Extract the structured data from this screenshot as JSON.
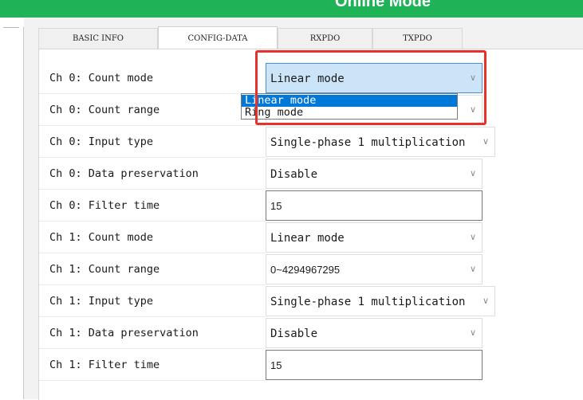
{
  "header": {
    "title": "Online Mode"
  },
  "tabs": [
    {
      "label": "BASIC INFO",
      "active": false
    },
    {
      "label": "CONFIG-DATA",
      "active": true
    },
    {
      "label": "RXPDO",
      "active": false
    },
    {
      "label": "TXPDO",
      "active": false
    }
  ],
  "rows": [
    {
      "label": "Ch 0: Count mode",
      "control": "select",
      "value": "Linear mode"
    },
    {
      "label": "Ch 0: Count range",
      "control": "select",
      "value": ""
    },
    {
      "label": "Ch 0: Input type",
      "control": "select",
      "value": "Single-phase 1 multiplication"
    },
    {
      "label": "Ch 0: Data preservation",
      "control": "select",
      "value": "Disable"
    },
    {
      "label": "Ch 0: Filter time",
      "control": "input",
      "value": "15"
    },
    {
      "label": "Ch 1: Count mode",
      "control": "select",
      "value": "Linear mode"
    },
    {
      "label": "Ch 1: Count range",
      "control": "select",
      "value": "0~4294967295"
    },
    {
      "label": "Ch 1: Input type",
      "control": "select",
      "value": "Single-phase 1 multiplication"
    },
    {
      "label": "Ch 1: Data preservation",
      "control": "select",
      "value": "Disable"
    },
    {
      "label": "Ch 1: Filter time",
      "control": "input",
      "value": "15"
    }
  ],
  "dropdown": {
    "options": [
      "Linear mode",
      "Ring mode"
    ],
    "selected": "Linear mode"
  },
  "icons": {
    "chevron": "chevron-down-icon"
  },
  "colors": {
    "header_bg": "#1fb257",
    "focus_bg": "#cce4f7",
    "selected_option": "#0078d7",
    "highlight_border": "#e8312a"
  }
}
